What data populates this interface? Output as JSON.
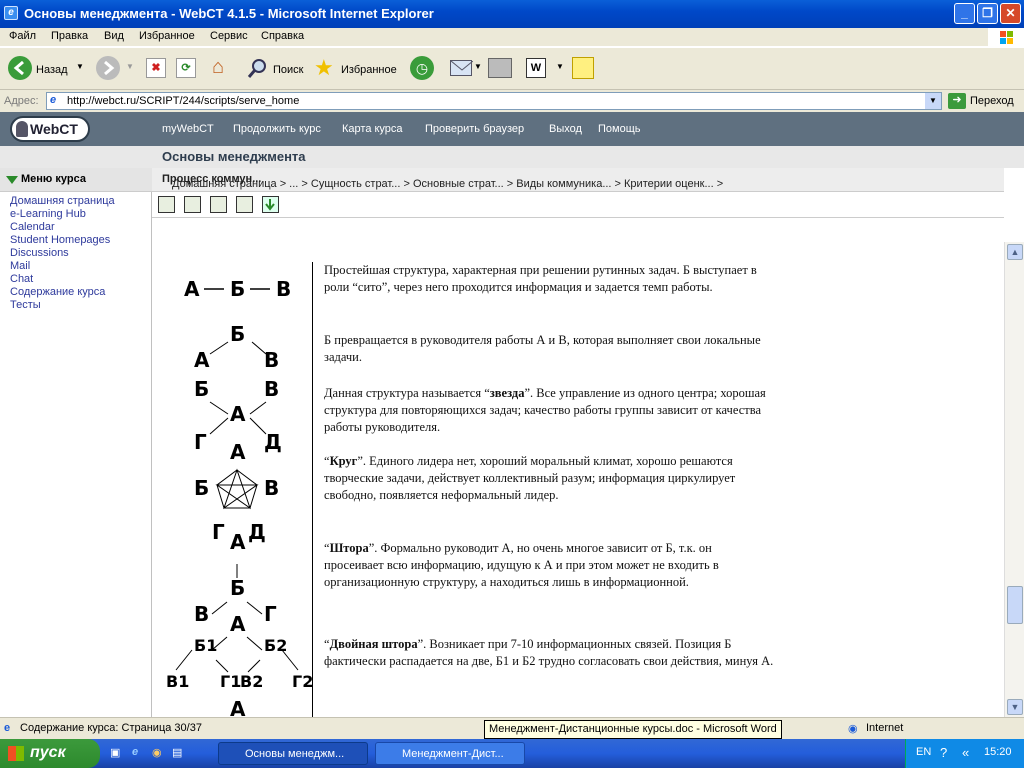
{
  "window": {
    "title": "Основы менеджмента - WebCT 4.1.5 - Microsoft Internet Explorer",
    "icon_letter": "e"
  },
  "menubar": [
    "Файл",
    "Правка",
    "Вид",
    "Избранное",
    "Сервис",
    "Справка"
  ],
  "toolbar": {
    "back_label": "Назад",
    "search_label": "Поиск",
    "favorites_label": "Избранное"
  },
  "address": {
    "label": "Адрес:",
    "url": "http://webct.ru/SCRIPT/244/scripts/serve_home",
    "go_label": "Переход"
  },
  "webct_nav": {
    "logo": "WebCT",
    "links": [
      "myWebCT",
      "Продолжить курс",
      "Карта курса",
      "Проверить браузер",
      "Выход",
      "Помощь"
    ]
  },
  "course_title": "Основы менеджмента",
  "sidebar": {
    "header": "Меню курса",
    "items": [
      "Домашняя страница",
      "e-Learning Hub",
      "Calendar",
      "Student Homepages",
      "Discussions",
      "Mail",
      "Chat",
      "Содержание курса",
      "Тесты"
    ]
  },
  "breadcrumb": {
    "path": "Домашняя страница > ... > Сущность страт... > Основные страт... > Виды коммуника... > Критерии оценк... > ",
    "current": "Процесс коммун..."
  },
  "diagram_letters": {
    "chain": [
      "А",
      "Б",
      "В"
    ],
    "wheel": [
      "Б",
      "А",
      "В"
    ],
    "star": [
      "Б",
      "В",
      "А",
      "Г",
      "Д"
    ],
    "circle": [
      "А",
      "Б",
      "В",
      "Г",
      "Д"
    ],
    "fork": [
      "А",
      "Б",
      "В",
      "Г"
    ],
    "double": [
      "А",
      "Б1",
      "Б2",
      "В1",
      "Г1",
      "В2",
      "Г2",
      "А"
    ]
  },
  "paragraphs": [
    {
      "bold": "",
      "text": "Простейшая структура, характерная при решении рутинных задач. Б выступает в роли “сито”, через него проходится информация и задается темп работы."
    },
    {
      "bold": "",
      "text": "Б превращается в руководителя работы А и В, которая выполняет свои локальные задачи."
    },
    {
      "bold": "звезда",
      "pre": "Данная структура называется “",
      "text": "”. Все управление из одного центра; хорошая структура для повторяющихся задач; качество работы группы зависит от качества работы руководителя."
    },
    {
      "bold": "Круг",
      "pre": "“",
      "text": "”. Единого лидера нет, хороший моральный климат, хорошо решаются творческие задачи, действует коллективный разум; информация циркулирует свободно, появляется неформальный лидер."
    },
    {
      "bold": "Штора",
      "pre": "“",
      "text": "”. Формально руководит А, но очень многое зависит от Б, т.к. он просеивает всю информацию, идущую к А и при этом может не входить в организационную структуру, а находиться лишь в информационной."
    },
    {
      "bold": "Двойная штора",
      "pre": "“",
      "text": "”. Возникает при 7-10 информационных связей. Позиция Б фактически распадается на две, Б1 и Б2 трудно согласовать свои действия, минуя А."
    }
  ],
  "status": {
    "text": "Содержание курса: Страница 30/37",
    "zone": "Internet"
  },
  "tooltip": "Менеджмент-Дистанционные курсы.doc - Microsoft Word",
  "taskbar": {
    "start": "пуск",
    "tasks": [
      "Основы менеджм...",
      "Менеджмент-Дист..."
    ],
    "lang": "EN",
    "clock": "15:20"
  },
  "colors": {
    "titlebar": "#0048c8",
    "webct_nav": "#5f7080",
    "sidebar_link": "#2e3a9c",
    "taskbar": "#245edb"
  }
}
